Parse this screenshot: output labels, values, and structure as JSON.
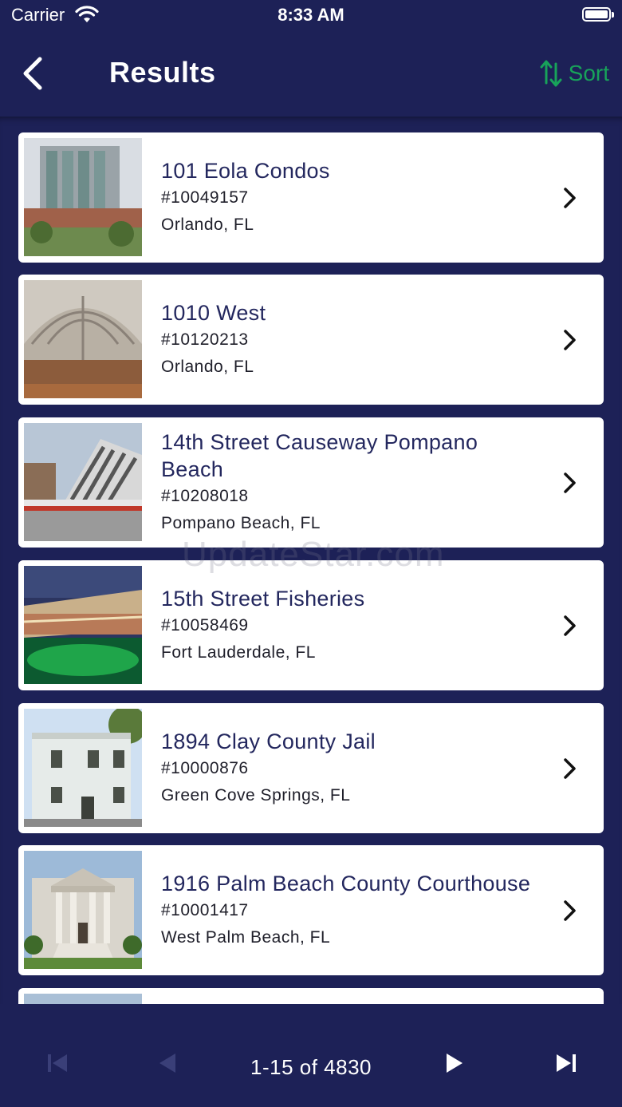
{
  "status_bar": {
    "carrier": "Carrier",
    "time": "8:33 AM"
  },
  "navbar": {
    "title": "Results",
    "sort_label": "Sort"
  },
  "results": [
    {
      "name": "101 Eola Condos",
      "number": "#10049157",
      "location": "Orlando, FL",
      "thumb_icon": "condo-tower-photo"
    },
    {
      "name": "1010 West",
      "number": "#10120213",
      "location": "Orlando, FL",
      "thumb_icon": "arched-hall-photo"
    },
    {
      "name": "14th Street Causeway Pompano Beach",
      "number": "#10208018",
      "location": "Pompano Beach, FL",
      "thumb_icon": "drawbridge-photo"
    },
    {
      "name": "15th Street Fisheries",
      "number": "#10058469",
      "location": "Fort Lauderdale, FL",
      "thumb_icon": "waterfront-restaurant-photo"
    },
    {
      "name": "1894 Clay County Jail",
      "number": "#10000876",
      "location": "Green Cove Springs, FL",
      "thumb_icon": "jail-building-photo"
    },
    {
      "name": "1916 Palm Beach County Courthouse",
      "number": "#10001417",
      "location": "West Palm Beach, FL",
      "thumb_icon": "courthouse-photo"
    }
  ],
  "watermark": "UpdateStar.com",
  "pagination": {
    "label": "1-15 of 4830"
  },
  "colors": {
    "background": "#1d2157",
    "accent": "#18a35a",
    "card": "#ffffff",
    "disabled": "#3a3f78"
  }
}
